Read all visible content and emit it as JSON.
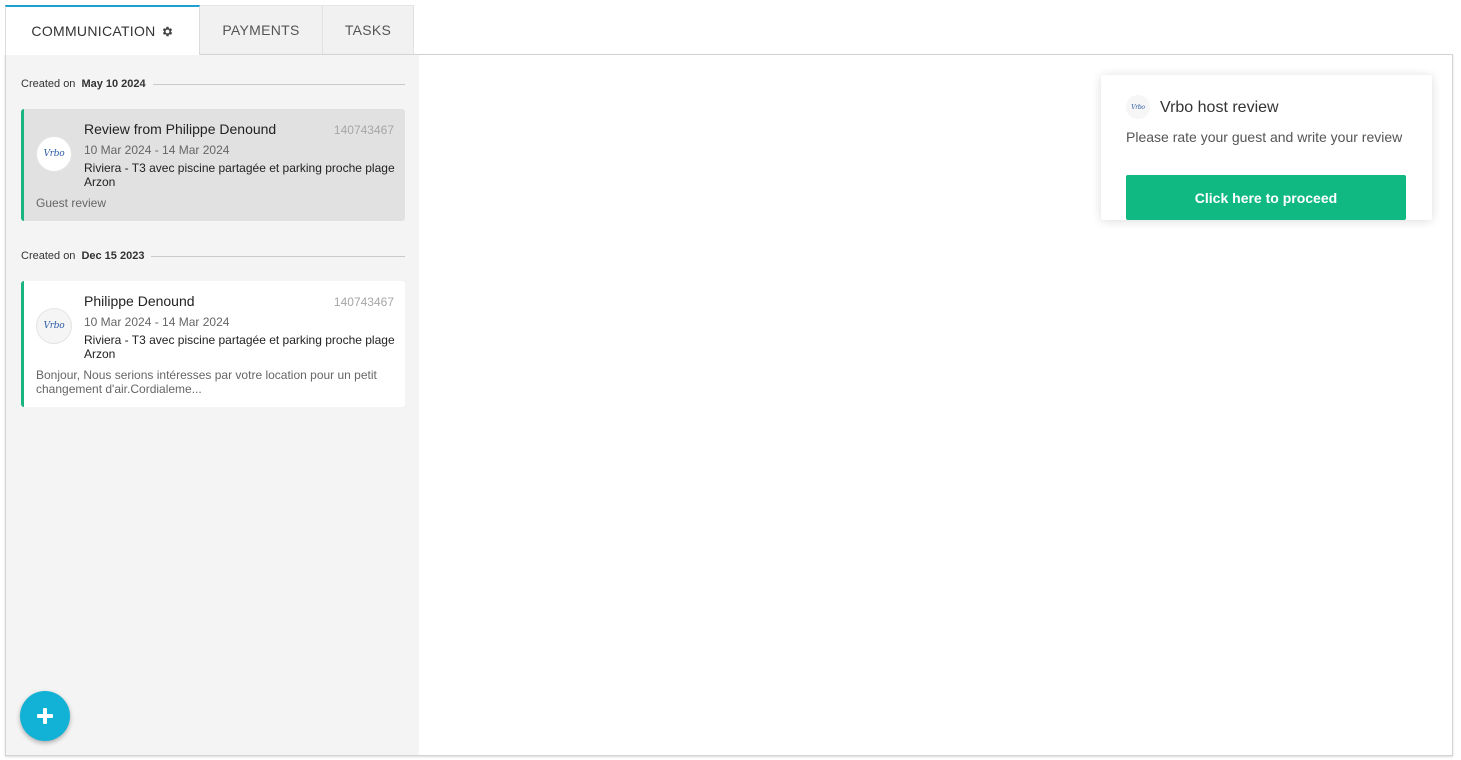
{
  "tabs": [
    {
      "label": "COMMUNICATION",
      "icon": "gear-icon"
    },
    {
      "label": "PAYMENTS"
    },
    {
      "label": "TASKS"
    }
  ],
  "conversations": [
    {
      "created_label": "Created on",
      "created_date": "May 10 2024",
      "title": "Review from Philippe Denound",
      "id": "140743467",
      "dates": "10 Mar 2024 - 14 Mar 2024",
      "property": "Riviera - T3 avec piscine partagée et parking proche plage Arzon",
      "snippet": "Guest review",
      "brand": "Vrbo"
    },
    {
      "created_label": "Created on",
      "created_date": "Dec 15 2023",
      "title": "Philippe Denound",
      "id": "140743467",
      "dates": "10 Mar 2024 - 14 Mar 2024",
      "property": "Riviera - T3 avec piscine partagée et parking proche plage Arzon",
      "snippet": "Bonjour, Nous serions intéresses par votre location pour un petit changement d'air.Cordialeme...",
      "brand": "Vrbo"
    }
  ],
  "review_card": {
    "brand": "Vrbo",
    "title": "Vrbo host review",
    "subtitle": "Please rate your guest and write your review",
    "button_label": "Click here to proceed"
  },
  "colors": {
    "accent": "#10b981",
    "tab_indicator": "#1b9fd4",
    "fab": "#12b2d6",
    "card_border": "#19b47f"
  }
}
